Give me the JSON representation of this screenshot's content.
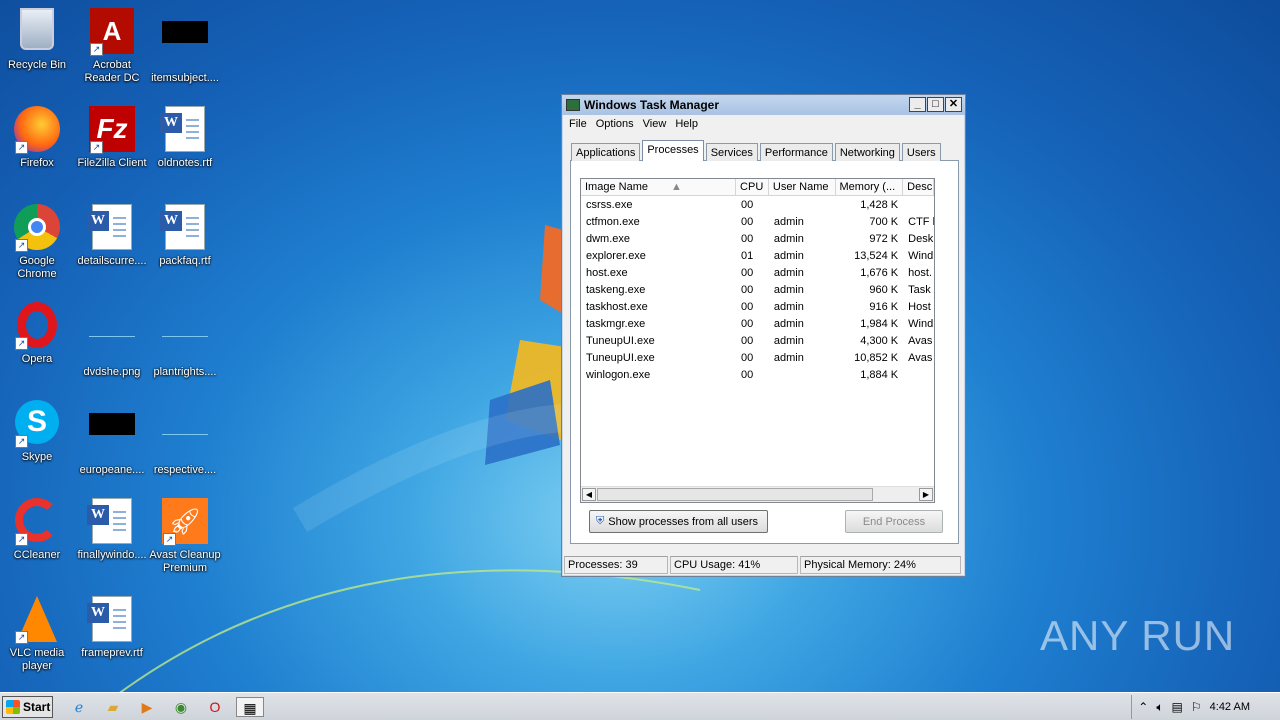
{
  "desktop": {
    "icons": [
      {
        "label": "Recycle Bin",
        "kind": "recycle"
      },
      {
        "label": "Acrobat Reader DC",
        "kind": "acrobat"
      },
      {
        "label": "itemsubject....",
        "kind": "black"
      },
      {
        "label": "Firefox",
        "kind": "firefox"
      },
      {
        "label": "FileZilla Client",
        "kind": "filezilla"
      },
      {
        "label": "oldnotes.rtf",
        "kind": "doc"
      },
      {
        "label": "Google Chrome",
        "kind": "chrome"
      },
      {
        "label": "detailscurre....",
        "kind": "doc"
      },
      {
        "label": "packfaq.rtf",
        "kind": "doc"
      },
      {
        "label": "Opera",
        "kind": "opera"
      },
      {
        "label": "dvdshe.png",
        "kind": "blank"
      },
      {
        "label": "plantrights....",
        "kind": "blank"
      },
      {
        "label": "Skype",
        "kind": "skype"
      },
      {
        "label": "europeane....",
        "kind": "black"
      },
      {
        "label": "respective....",
        "kind": "blank"
      },
      {
        "label": "CCleaner",
        "kind": "ccleaner"
      },
      {
        "label": "finallywindo....",
        "kind": "doc"
      },
      {
        "label": "Avast Cleanup Premium",
        "kind": "avast"
      },
      {
        "label": "VLC media player",
        "kind": "vlc"
      },
      {
        "label": "frameprev.rtf",
        "kind": "doc"
      }
    ]
  },
  "task_manager": {
    "title": "Windows Task Manager",
    "menu": [
      "File",
      "Options",
      "View",
      "Help"
    ],
    "tabs": [
      "Applications",
      "Processes",
      "Services",
      "Performance",
      "Networking",
      "Users"
    ],
    "active_tab": "Processes",
    "columns": [
      "Image Name",
      "CPU",
      "User Name",
      "Memory (...",
      "Desc"
    ],
    "processes": [
      {
        "name": "csrss.exe",
        "cpu": "00",
        "user": "",
        "memory": "1,428 K",
        "desc": ""
      },
      {
        "name": "ctfmon.exe",
        "cpu": "00",
        "user": "admin",
        "memory": "700 K",
        "desc": "CTF l"
      },
      {
        "name": "dwm.exe",
        "cpu": "00",
        "user": "admin",
        "memory": "972 K",
        "desc": "Desk"
      },
      {
        "name": "explorer.exe",
        "cpu": "01",
        "user": "admin",
        "memory": "13,524 K",
        "desc": "Wind"
      },
      {
        "name": "host.exe",
        "cpu": "00",
        "user": "admin",
        "memory": "1,676 K",
        "desc": "host."
      },
      {
        "name": "taskeng.exe",
        "cpu": "00",
        "user": "admin",
        "memory": "960 K",
        "desc": "Task"
      },
      {
        "name": "taskhost.exe",
        "cpu": "00",
        "user": "admin",
        "memory": "916 K",
        "desc": "Host"
      },
      {
        "name": "taskmgr.exe",
        "cpu": "00",
        "user": "admin",
        "memory": "1,984 K",
        "desc": "Wind"
      },
      {
        "name": "TuneupUI.exe",
        "cpu": "00",
        "user": "admin",
        "memory": "4,300 K",
        "desc": "Avas"
      },
      {
        "name": "TuneupUI.exe",
        "cpu": "00",
        "user": "admin",
        "memory": "10,852 K",
        "desc": "Avas"
      },
      {
        "name": "winlogon.exe",
        "cpu": "00",
        "user": "",
        "memory": "1,884 K",
        "desc": ""
      }
    ],
    "show_all_label": "Show processes from all users",
    "end_process_label": "End Process",
    "status": {
      "processes": "Processes: 39",
      "cpu": "CPU Usage: 41%",
      "memory": "Physical Memory: 24%"
    }
  },
  "taskbar": {
    "start_label": "Start",
    "clock": "4:42 AM"
  },
  "watermark": "ANY RUN"
}
